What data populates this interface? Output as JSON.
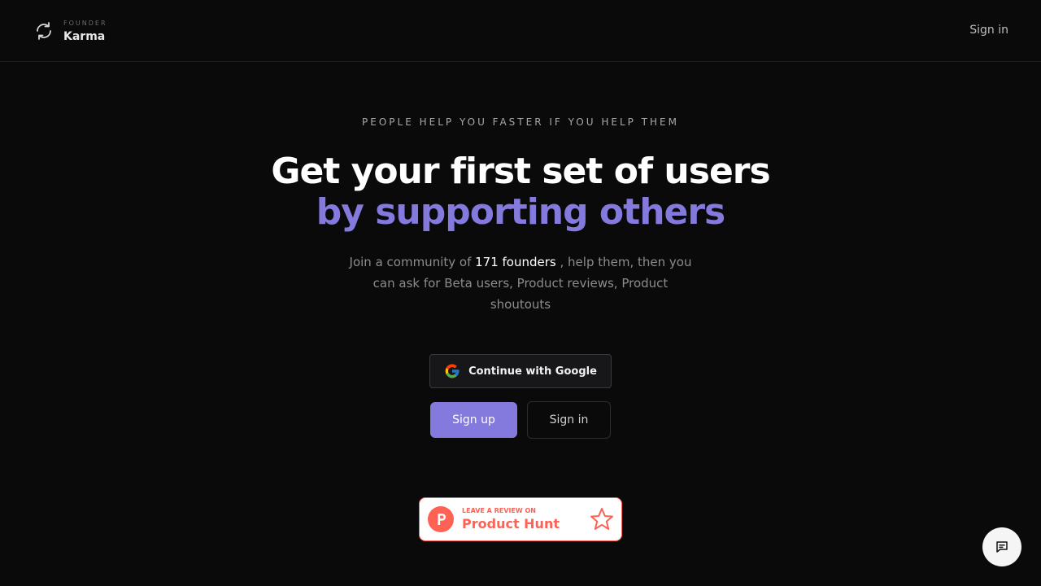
{
  "header": {
    "logo_small": "FOUNDER",
    "logo_big": "Karma",
    "logo_icon": "refresh-icon",
    "signin_label": "Sign in"
  },
  "hero": {
    "tagline": "PEOPLE HELP YOU FASTER IF YOU HELP THEM",
    "headline_line1": "Get your first set of users",
    "headline_line2": "by supporting others",
    "description_prefix": "Join a community of ",
    "description_highlight": "171 founders",
    "description_suffix": " , help them, then you can ask for Beta users, Product reviews, Product shoutouts"
  },
  "actions": {
    "google_label": "Continue with Google",
    "google_icon": "google-icon",
    "signup_label": "Sign up",
    "signin_label": "Sign in"
  },
  "product_hunt": {
    "small_text": "LEAVE A REVIEW ON",
    "big_text": "Product Hunt",
    "logo_icon": "product-hunt-icon",
    "star_icon": "star-icon"
  },
  "chat": {
    "icon": "chat-icon"
  },
  "colors": {
    "background": "#0a0a0a",
    "accent": "#8479dc",
    "product_hunt": "#ff6154"
  }
}
